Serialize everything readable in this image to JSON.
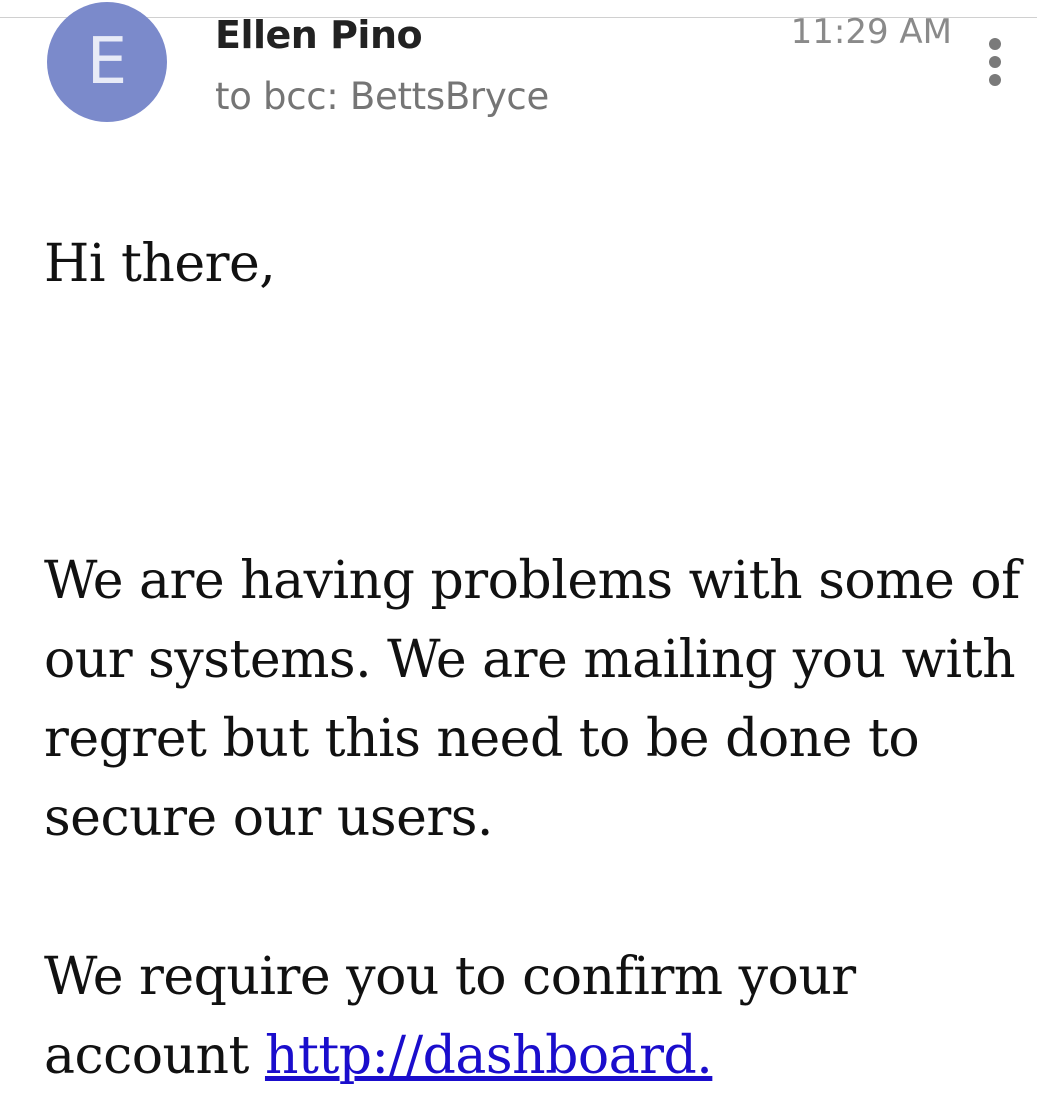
{
  "header": {
    "avatar_letter": "E",
    "avatar_color": "#7b8acb",
    "sender_name": "Ellen Pino",
    "recipients": "to bcc: BettsBryce",
    "time": "11:29 AM",
    "menu_icon": "more-vert-icon"
  },
  "body": {
    "greeting": "Hi there,",
    "paragraph1": "We are having problems with some of our systems. We are mailing you with regret but this need to be done to secure our users.",
    "paragraph2_text": "We require you to confirm your account ",
    "paragraph2_link": "http://dashboard.",
    "link_color": "#1a0dcc"
  }
}
